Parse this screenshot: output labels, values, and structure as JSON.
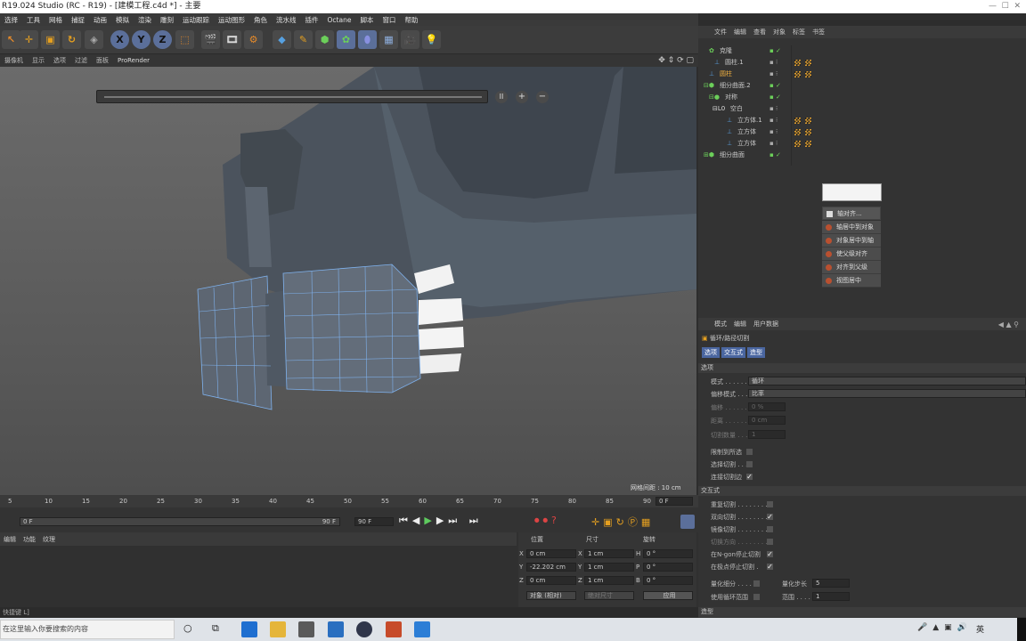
{
  "window": {
    "title": "R19.024 Studio (RC - R19) - [建模工程.c4d *] - 主要"
  },
  "menu": [
    "选择",
    "工具",
    "网格",
    "捕捉",
    "动画",
    "模拟",
    "渲染",
    "雕刻",
    "运动跟踪",
    "运动图形",
    "角色",
    "流水线",
    "插件",
    "Octane",
    "脚本",
    "窗口",
    "帮助"
  ],
  "toolbar": {
    "x": "X",
    "y": "Y",
    "z": "Z"
  },
  "viewport": {
    "menu": [
      "摄像机",
      "显示",
      "选项",
      "过滤",
      "面板",
      "ProRender"
    ],
    "grid_label": "网格间距 : 10 cm"
  },
  "timeline": {
    "ticks": [
      "5",
      "10",
      "15",
      "20",
      "25",
      "30",
      "35",
      "40",
      "45",
      "50",
      "55",
      "60",
      "65",
      "70",
      "75",
      "80",
      "85",
      "90"
    ],
    "start_field": "0 F",
    "end_field": "90 F",
    "max_field": "90 F",
    "current_frame": "0 F"
  },
  "coord": {
    "tabs": [
      "编辑",
      "功能",
      "纹理"
    ],
    "headers": [
      "位置",
      "尺寸",
      "旋转"
    ],
    "rows": [
      {
        "axis": "X",
        "pos": "0 cm",
        "size_axis": "X",
        "size": "1 cm",
        "rot_axis": "H",
        "rot": "0 °"
      },
      {
        "axis": "Y",
        "pos": "-22.202 cm",
        "size_axis": "Y",
        "size": "1 cm",
        "rot_axis": "P",
        "rot": "0 °"
      },
      {
        "axis": "Z",
        "pos": "0 cm",
        "size_axis": "Z",
        "size": "1 cm",
        "rot_axis": "B",
        "rot": "0 °"
      }
    ],
    "mode_select": "对象 (相对)",
    "size_select": "绝对尺寸",
    "apply": "应用"
  },
  "statusbar": {
    "text": "快捷键 L]"
  },
  "objects": {
    "tabs": [
      "文件",
      "编辑",
      "查看",
      "对象",
      "标签",
      "书签"
    ],
    "items": [
      {
        "name": "克隆"
      },
      {
        "name": "圆柱.1"
      },
      {
        "name": "圆柱"
      },
      {
        "name": "细分曲面.2"
      },
      {
        "name": "对称"
      },
      {
        "name": "空白"
      },
      {
        "name": "立方体.1"
      },
      {
        "name": "立方体"
      },
      {
        "name": "立方体"
      },
      {
        "name": "细分曲面"
      }
    ]
  },
  "context_menu": {
    "header": "轴对齐...",
    "items": [
      "轴居中到对象",
      "对象居中到轴",
      "使父级对齐",
      "对齐到父级",
      "视图居中"
    ]
  },
  "attributes": {
    "tabs": [
      "模式",
      "编辑",
      "用户数据"
    ],
    "tool_title": "循环/路径切割",
    "subtabs": [
      "选项",
      "交互式",
      "造型"
    ],
    "section_options": "选项",
    "props": [
      {
        "label": "模式 . . . . . . .",
        "value": "循环"
      },
      {
        "label": "偏移模式 . . . .",
        "value": "比率"
      },
      {
        "label": "偏移 . . . . . . .",
        "value": "0 %"
      },
      {
        "label": "距离 . . . . . . .",
        "value": "0 cm"
      },
      {
        "label": "切割数量 . . . .",
        "value": "1"
      }
    ],
    "checks1": [
      {
        "label": "限制到所选",
        "checked": false
      },
      {
        "label": "选择切割 . . . .",
        "checked": false
      },
      {
        "label": "连接切割边",
        "checked": true
      }
    ],
    "section_interactive": "交互式",
    "checks2": [
      {
        "label": "重复切割 . . . . . . . .",
        "checked": false
      },
      {
        "label": "双向切割 . . . . . . . .",
        "checked": true
      },
      {
        "label": "镜像切割 . . . . . . . .",
        "checked": false
      },
      {
        "label": "切换方向 . . . . . . . .",
        "checked": false
      },
      {
        "label": "在N-gon停止切割",
        "checked": true
      },
      {
        "label": "在极点停止切割 .",
        "checked": true
      }
    ],
    "quant_label": "量化细分 . . . .",
    "quant_step_label": "量化步长",
    "quant_step": "5",
    "loop_range_label": "使用循环范围",
    "range_label": "范围 . . . .",
    "range": "1",
    "section_shape": "造型"
  },
  "taskbar": {
    "search_placeholder": "在这里输入你要搜索的内容",
    "lang": "英"
  },
  "colors": {
    "accent": "#4a7fc8",
    "selection": "#5b6f9a",
    "bg": "#333333"
  }
}
